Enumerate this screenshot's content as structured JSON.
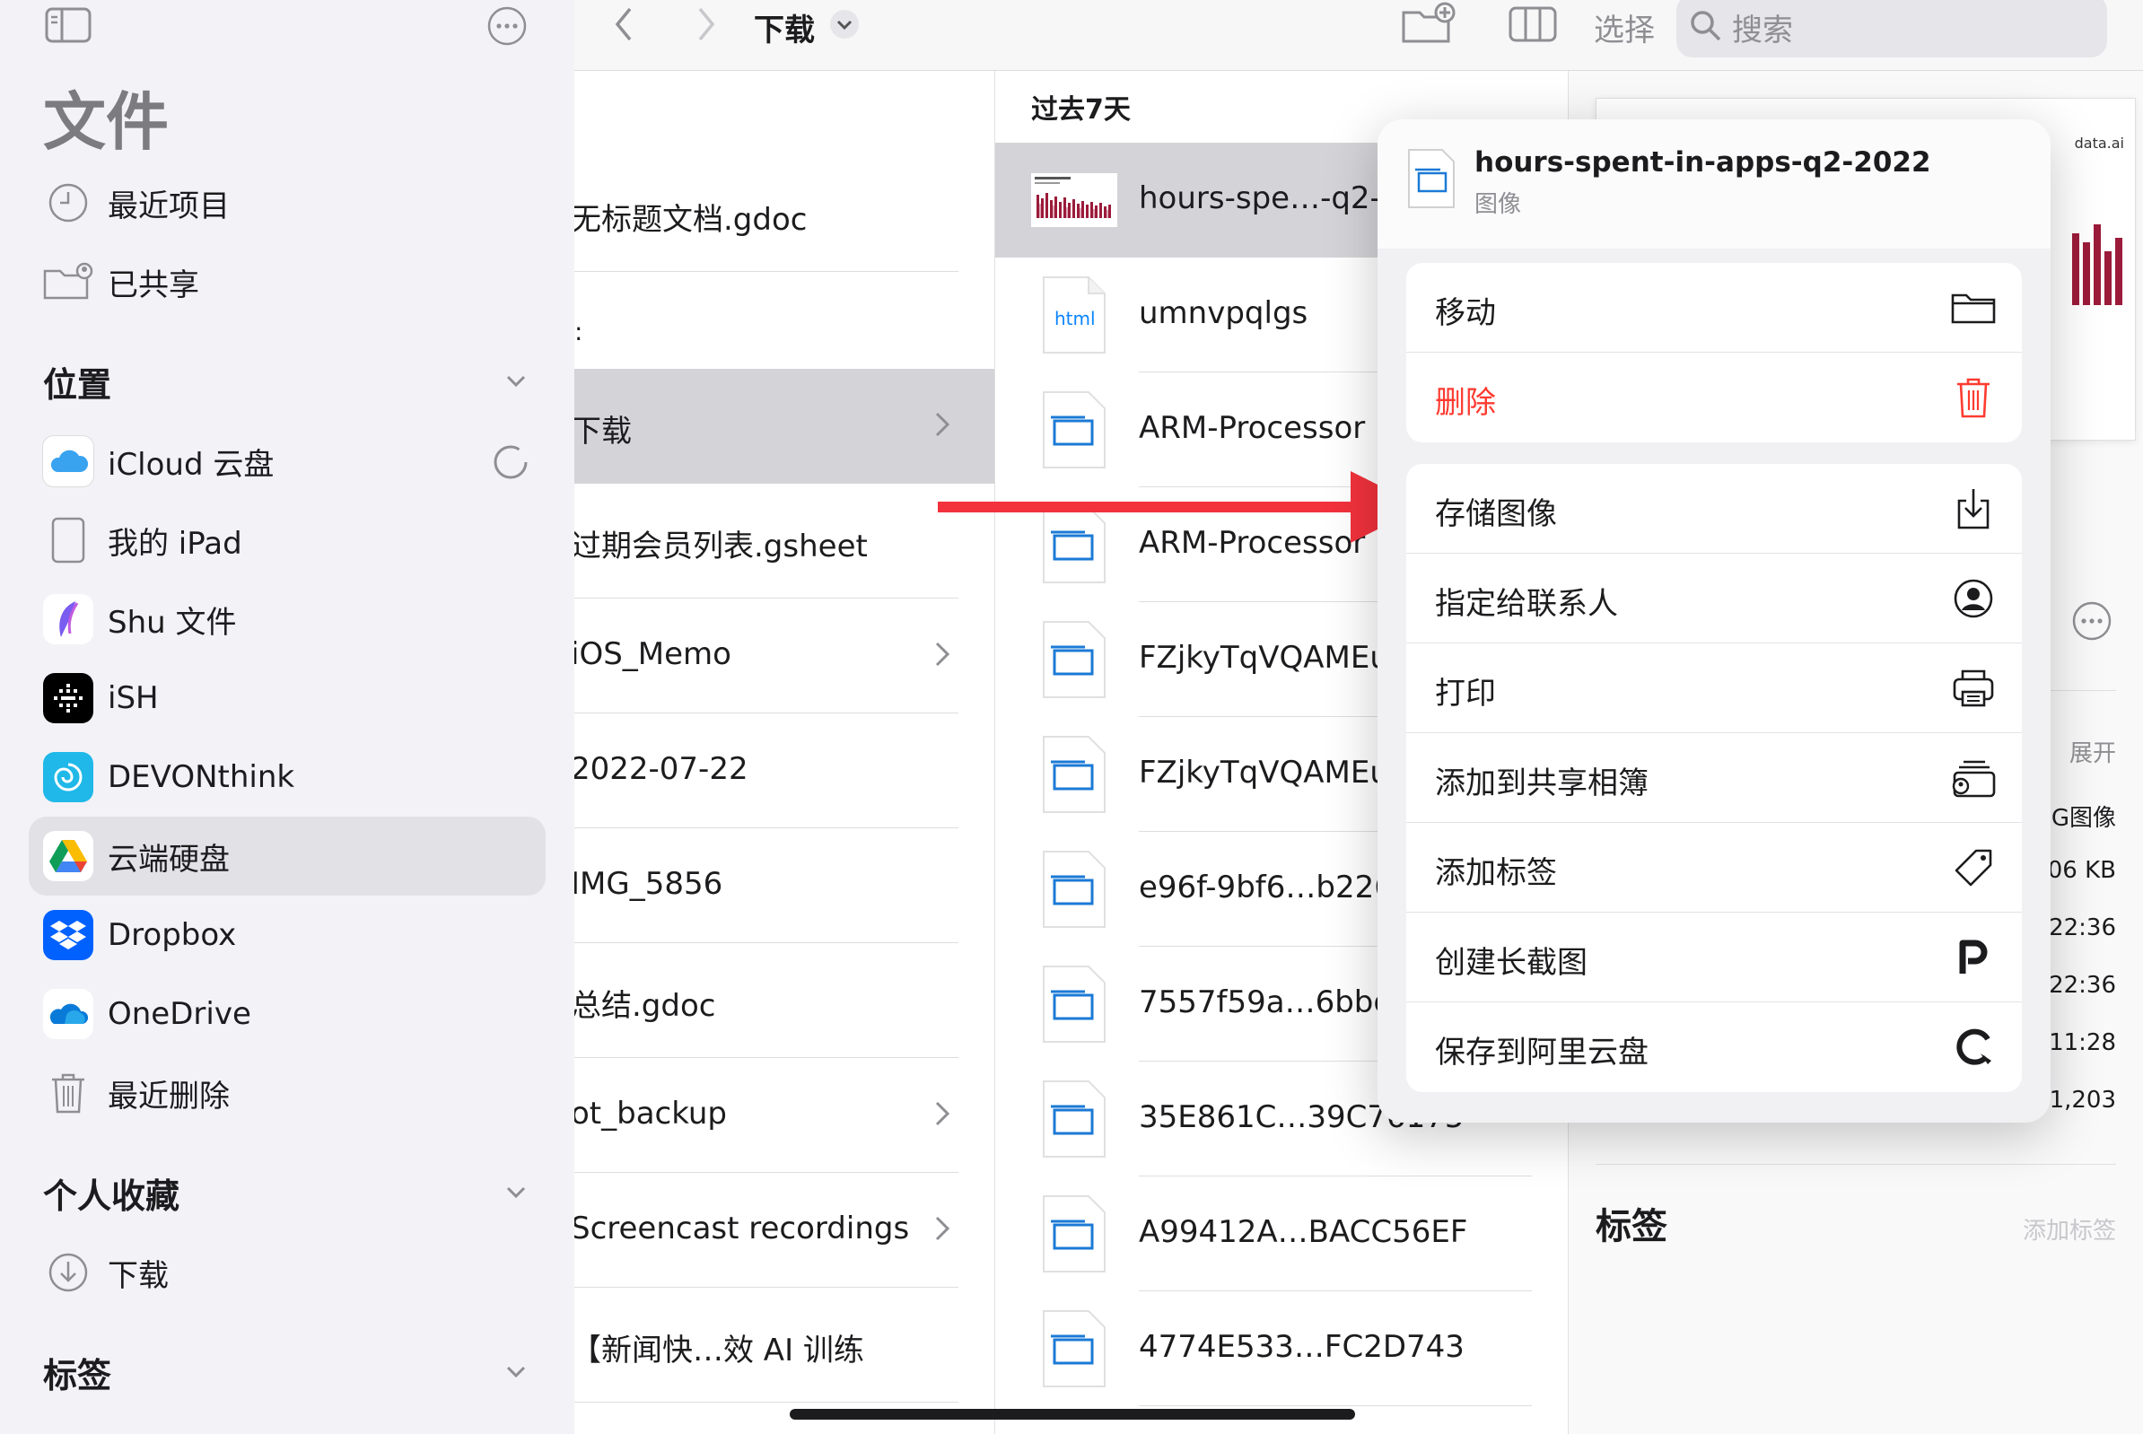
{
  "sidebar": {
    "title": "文件",
    "recents": "最近项目",
    "shared": "已共享",
    "locations_header": "位置",
    "locations": [
      "iCloud 云盘",
      "我的 iPad",
      "Shu 文件",
      "iSH",
      "DEVONthink",
      "云端硬盘",
      "Dropbox",
      "OneDrive",
      "最近删除"
    ],
    "favorites_header": "个人收藏",
    "favorites": [
      "下载"
    ],
    "tags_header": "标签"
  },
  "toolbar": {
    "title": "下载",
    "select": "选择",
    "search_placeholder": "搜索"
  },
  "column1": {
    "rows": [
      "无标题文档.gdoc",
      "",
      "下载",
      "过期会员列表.gsheet",
      "iOS_Memo",
      "2022-07-22",
      "IMG_5856",
      "总结.gdoc",
      "ot_backup",
      "Screencast recordings",
      "【新闻快…效 AI 训练"
    ]
  },
  "column2": {
    "header": "过去7天",
    "html_label": "html",
    "files": [
      "hours-spe…-q2-2022",
      "umnvpqlgs",
      "ARM-Processor",
      "ARM-Processor",
      "FZjkyTqVQAMEut",
      "FZjkyTqVQAMEut",
      "e96f-9bf6…b226",
      "7557f59a…6bbd1",
      "35E861C…39C76175",
      "A99412A…BACC56EF",
      "4774E533…FC2D743"
    ]
  },
  "preview": {
    "thumb_text": "data.ai",
    "expand": "展开",
    "kind": "PNG图像",
    "size": "106 KB",
    "created": "22:36",
    "modified": "22:36",
    "opened": "11:28",
    "dimensions": "1,203",
    "tags_title": "标签",
    "add_tags": "添加标签"
  },
  "context_menu": {
    "title": "hours-spent-in-apps-q2-2022",
    "subtitle": "图像",
    "move": "移动",
    "delete": "删除",
    "save_image": "存储图像",
    "assign_contact": "指定给联系人",
    "print": "打印",
    "add_shared_album": "添加到共享相簿",
    "add_tags": "添加标签",
    "long_screenshot": "创建长截图",
    "save_aliyun": "保存到阿里云盘"
  },
  "colors": {
    "accent": "#007aff",
    "destructive": "#ff3b30",
    "arrow": "#f2323c",
    "selection": "#d4d4d8"
  }
}
